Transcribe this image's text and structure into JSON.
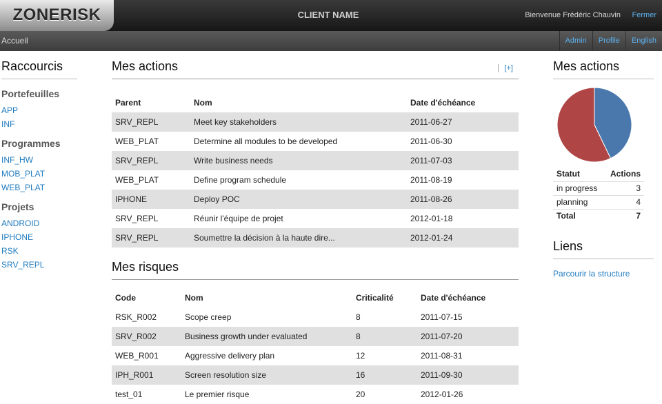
{
  "header": {
    "logo": "ZONERISK",
    "client_name": "CLIENT NAME",
    "welcome": "Bienvenue Frédéric Chauvin",
    "logout": "Fermer"
  },
  "nav": {
    "home": "Accueil",
    "links": [
      "Admin",
      "Profile",
      "English"
    ]
  },
  "shortcuts": {
    "title": "Raccourcis",
    "groups": [
      {
        "title": "Portefeuilles",
        "items": [
          "APP",
          "INF"
        ]
      },
      {
        "title": "Programmes",
        "items": [
          "INF_HW",
          "MOB_PLAT",
          "WEB_PLAT"
        ]
      },
      {
        "title": "Projets",
        "items": [
          "ANDROID",
          "IPHONE",
          "RSK",
          "SRV_REPL"
        ]
      }
    ]
  },
  "actions": {
    "title": "Mes actions",
    "add_label": "[+]",
    "columns": [
      "Parent",
      "Nom",
      "Date d'échéance"
    ],
    "rows": [
      [
        "SRV_REPL",
        "Meet key stakeholders",
        "2011-06-27"
      ],
      [
        "WEB_PLAT",
        "Determine all modules to be developed",
        "2011-06-30"
      ],
      [
        "SRV_REPL",
        "Write business needs",
        "2011-07-03"
      ],
      [
        "WEB_PLAT",
        "Define program schedule",
        "2011-08-19"
      ],
      [
        "IPHONE",
        "Deploy POC",
        "2011-08-26"
      ],
      [
        "SRV_REPL",
        "Réunir l'équipe de projet",
        "2012-01-18"
      ],
      [
        "SRV_REPL",
        "Soumettre la décision à la haute dire...",
        "2012-01-24"
      ]
    ]
  },
  "risks": {
    "title": "Mes risques",
    "columns": [
      "Code",
      "Nom",
      "Criticalité",
      "Date d'échéance"
    ],
    "rows": [
      [
        "RSK_R002",
        "Scope creep",
        "8",
        "2011-07-15"
      ],
      [
        "SRV_R002",
        "Business growth under evaluated",
        "8",
        "2011-07-20"
      ],
      [
        "WEB_R001",
        "Aggressive delivery plan",
        "12",
        "2011-08-31"
      ],
      [
        "IPH_R001",
        "Screen resolution size",
        "16",
        "2011-09-30"
      ],
      [
        "test_01",
        "Le premier risque",
        "20",
        "2012-01-26"
      ]
    ]
  },
  "summary": {
    "title": "Mes actions",
    "columns": [
      "Statut",
      "Actions"
    ],
    "rows": [
      {
        "status": "in progress",
        "count": "3"
      },
      {
        "status": "planning",
        "count": "4"
      }
    ],
    "total_label": "Total",
    "total_value": "7",
    "pie_colors": [
      "#4a78ad",
      "#b04545"
    ]
  },
  "chart_data": {
    "type": "pie",
    "categories": [
      "in progress",
      "planning"
    ],
    "values": [
      3,
      4
    ],
    "title": ""
  },
  "links": {
    "title": "Liens",
    "items": [
      "Parcourir la structure"
    ]
  }
}
